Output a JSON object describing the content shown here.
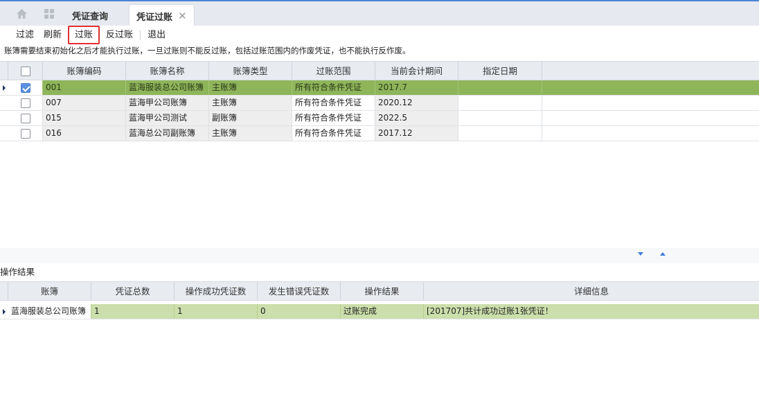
{
  "tabs": {
    "items": [
      {
        "label": "凭证查询"
      },
      {
        "label": "凭证过账"
      }
    ],
    "close_glyph": "✕"
  },
  "toolbar": {
    "buttons": [
      {
        "label": "过滤"
      },
      {
        "label": "刷新"
      },
      {
        "label": "过账"
      },
      {
        "label": "反过账"
      },
      {
        "label": "退出"
      }
    ]
  },
  "notice": "账簿需要结束初始化之后才能执行过账，一旦过账则不能反过账，包括过账范围内的作废凭证，也不能执行反作废。",
  "books_table": {
    "columns": [
      "账簿编码",
      "账簿名称",
      "账簿类型",
      "过账范围",
      "当前会计期间",
      "指定日期"
    ],
    "rows": [
      {
        "code": "001",
        "name": "蓝海服装总公司账簿",
        "type": "主账簿",
        "scope": "所有符合条件凭证",
        "period": "2017.7",
        "date": "",
        "checked": true
      },
      {
        "code": "007",
        "name": "蓝海甲公司账簿",
        "type": "主账簿",
        "scope": "所有符合条件凭证",
        "period": "2020.12",
        "date": "",
        "checked": false
      },
      {
        "code": "015",
        "name": "蓝海甲公司测试",
        "type": "副账簿",
        "scope": "所有符合条件凭证",
        "period": "2022.5",
        "date": "",
        "checked": false
      },
      {
        "code": "016",
        "name": "蓝海总公司副账簿",
        "type": "主账簿",
        "scope": "所有符合条件凭证",
        "period": "2017.12",
        "date": "",
        "checked": false
      }
    ]
  },
  "result_section": {
    "title": "操作结果",
    "columns": [
      "账簿",
      "凭证总数",
      "操作成功凭证数",
      "发生错误凭证数",
      "操作结果",
      "详细信息"
    ],
    "rows": [
      {
        "book": "蓝海服装总公司账簿",
        "total": "1",
        "success": "1",
        "errors": "0",
        "result": "过账完成",
        "detail": "[201707]共计成功过账1张凭证！"
      }
    ]
  },
  "colors": {
    "selected_row": "#8fb55a",
    "result_row": "#cbdeab",
    "header_bg": "#e8ebf0",
    "highlight_border": "#e03030",
    "accent": "#4b82d6"
  }
}
